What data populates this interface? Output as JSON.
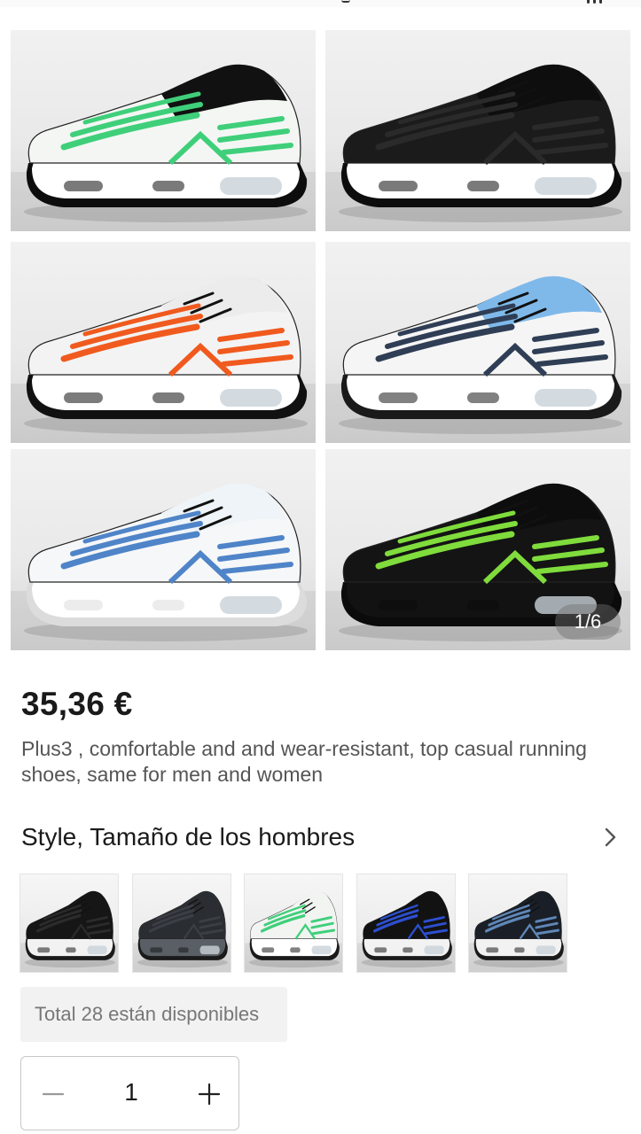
{
  "gallery": {
    "images": [
      {
        "name": "black white and green sneaker",
        "upper": "#f4f6f4",
        "top": "#111111",
        "accent": "#3fcf7a",
        "sole": "#ffffff",
        "bottom": "#0d0d0d"
      },
      {
        "name": "all black sneaker",
        "upper": "#1b1b1b",
        "top": "#0e0e0e",
        "accent": "#2a2a2a",
        "sole": "#ffffff",
        "bottom": "#0d0d0d"
      },
      {
        "name": "white black and orange sneaker",
        "upper": "#f3f3f3",
        "top": "#ececec",
        "accent": "#f05a1e",
        "sole": "#ffffff",
        "bottom": "#111111"
      },
      {
        "name": "white black and sky blue sneaker",
        "upper": "#f5f5f5",
        "top": "#7fb9ea",
        "accent": "#2f3e55",
        "sole": "#ffffff",
        "bottom": "#1a1a1a"
      },
      {
        "name": "white blue and teal sneaker",
        "upper": "#f6f7f8",
        "top": "#eef4f7",
        "accent": "#4f84c8",
        "sole": "#ffffff",
        "bottom": "#dcdcdc"
      },
      {
        "name": "black camo and neon green sneaker",
        "upper": "#141414",
        "top": "#0d0d0d",
        "accent": "#7fdc3c",
        "sole": "#121212",
        "bottom": "#0b0b0b"
      }
    ],
    "counter": "1/6"
  },
  "product": {
    "price": "35,36 €",
    "description": "Plus3 , comfortable and and wear-resistant, top casual running shoes, same for men and women"
  },
  "options": {
    "title": "Style, Tamaño de los hombres",
    "variants": [
      {
        "name": "black variant",
        "upper": "#161616",
        "accent": "#2b2b2b",
        "sole": "#f2f2f2"
      },
      {
        "name": "dark grey variant",
        "upper": "#2a2d31",
        "accent": "#3b3f45",
        "sole": "#5a5f66"
      },
      {
        "name": "green gradient variant",
        "upper": "#f2f4f2",
        "accent": "#3fcf7a",
        "sole": "#ffffff"
      },
      {
        "name": "black and blue variant",
        "upper": "#121212",
        "accent": "#2c4fd0",
        "sole": "#f2f2f2"
      },
      {
        "name": "blue grey variant",
        "upper": "#1a1f27",
        "accent": "#5f87b8",
        "sole": "#f2f2f2"
      }
    ],
    "stock_text": "Total 28 están disponibles",
    "quantity": "1"
  },
  "colors": {
    "price": "#1a1a1a",
    "muted_text": "#555555",
    "counter_bg": "#6e6e6e"
  },
  "icons": {
    "option_arrow": "chevron-right-icon",
    "decrease": "minus-icon",
    "increase": "plus-icon"
  }
}
